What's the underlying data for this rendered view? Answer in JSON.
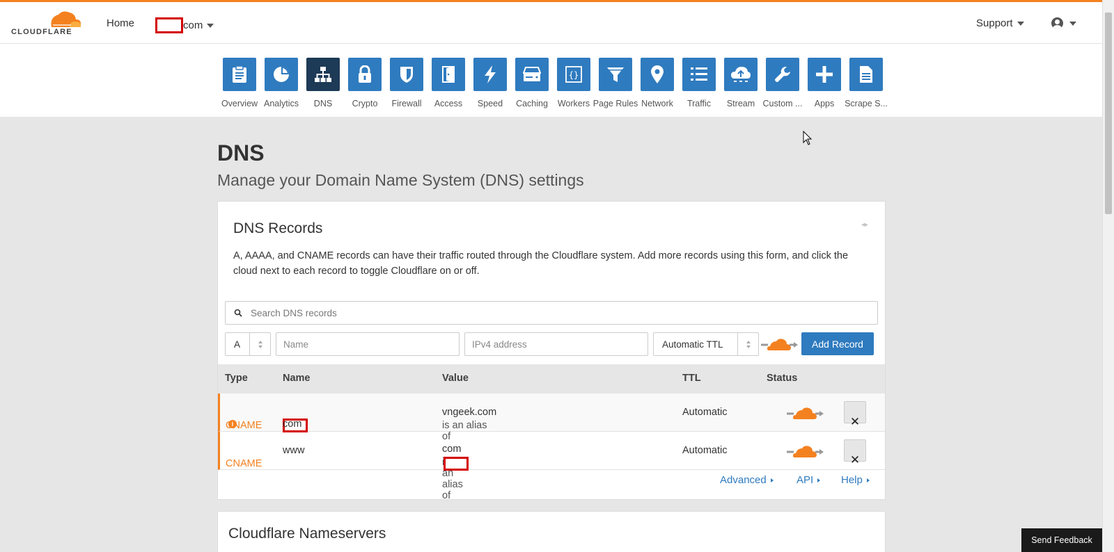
{
  "header": {
    "logo_text": "CLOUDFLARE",
    "home_label": "Home",
    "domain_suffix": "com",
    "support_label": "Support"
  },
  "apps": [
    {
      "label": "Overview",
      "icon": "clipboard-icon"
    },
    {
      "label": "Analytics",
      "icon": "pie-chart-icon"
    },
    {
      "label": "DNS",
      "icon": "sitemap-icon",
      "active": true
    },
    {
      "label": "Crypto",
      "icon": "lock-icon"
    },
    {
      "label": "Firewall",
      "icon": "shield-icon"
    },
    {
      "label": "Access",
      "icon": "door-icon"
    },
    {
      "label": "Speed",
      "icon": "lightning-icon"
    },
    {
      "label": "Caching",
      "icon": "server-icon"
    },
    {
      "label": "Workers",
      "icon": "code-brackets-icon"
    },
    {
      "label": "Page Rules",
      "icon": "filter-icon"
    },
    {
      "label": "Network",
      "icon": "map-pin-icon"
    },
    {
      "label": "Traffic",
      "icon": "list-icon"
    },
    {
      "label": "Stream",
      "icon": "cloud-upload-icon"
    },
    {
      "label": "Custom ...",
      "icon": "wrench-icon"
    },
    {
      "label": "Apps",
      "icon": "plus-icon"
    },
    {
      "label": "Scrape S...",
      "icon": "document-icon"
    }
  ],
  "page": {
    "title": "DNS",
    "subtitle": "Manage your Domain Name System (DNS) settings"
  },
  "dns_records": {
    "title": "DNS Records",
    "description": "A, AAAA, and CNAME records can have their traffic routed through the Cloudflare system. Add more records using this form, and click the cloud next to each record to toggle Cloudflare on or off.",
    "search_placeholder": "Search DNS records",
    "form": {
      "type_value": "A",
      "name_placeholder": "Name",
      "value_placeholder": "IPv4 address",
      "ttl_value": "Automatic TTL",
      "add_button": "Add Record"
    },
    "columns": {
      "type": "Type",
      "name": "Name",
      "value": "Value",
      "ttl": "TTL",
      "status": "Status"
    },
    "rows": [
      {
        "type": "CNAME",
        "name_suffix": "com",
        "alias_prefix": "is an alias of",
        "alias_target": "vngeek.com",
        "ttl": "Automatic"
      },
      {
        "type": "CNAME",
        "name": "www",
        "alias_prefix": "is an alias of",
        "alias_suffix": "com",
        "ttl": "Automatic"
      }
    ],
    "links": {
      "advanced": "Advanced",
      "api": "API",
      "help": "Help"
    }
  },
  "nameservers": {
    "title": "Cloudflare Nameservers"
  },
  "feedback_label": "Send Feedback",
  "colors": {
    "accent_orange": "#f48120",
    "primary_blue": "#2f7bbf",
    "active_tile": "#1d3a56"
  }
}
